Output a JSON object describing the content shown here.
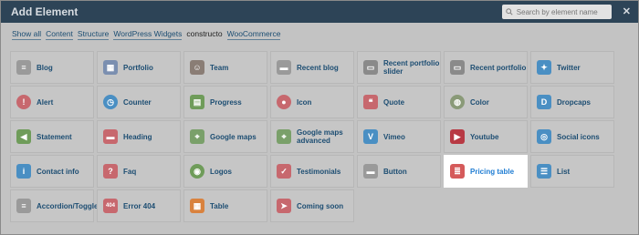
{
  "header": {
    "title": "Add Element",
    "search_placeholder": "Search by element name",
    "close": "✕"
  },
  "filters": [
    "Show all",
    "Content",
    "Structure",
    "WordPress Widgets",
    "constructo",
    "WooCommerce"
  ],
  "items": [
    {
      "label": "Blog",
      "icon": "blog-icon",
      "color": "#9a9a9a"
    },
    {
      "label": "Portfolio",
      "icon": "portfolio-icon",
      "color": "#7b8fb0"
    },
    {
      "label": "Team",
      "icon": "team-icon",
      "color": "#8a7d75"
    },
    {
      "label": "Recent blog",
      "icon": "recent-blog-icon",
      "color": "#9a9a9a"
    },
    {
      "label": "Recent portfolio slider",
      "icon": "recent-portfolio-slider-icon",
      "color": "#8a8a8a"
    },
    {
      "label": "Recent portfolio",
      "icon": "recent-portfolio-icon",
      "color": "#8a8a8a"
    },
    {
      "label": "Twitter",
      "icon": "twitter-icon",
      "color": "#4a8fc3"
    },
    {
      "label": "Alert",
      "icon": "alert-icon",
      "color": "#c7686e"
    },
    {
      "label": "Counter",
      "icon": "counter-icon",
      "color": "#4a8fc3"
    },
    {
      "label": "Progress",
      "icon": "progress-icon",
      "color": "#6f9c5a"
    },
    {
      "label": "Icon",
      "icon": "icon-icon",
      "color": "#c7686e"
    },
    {
      "label": "Quote",
      "icon": "quote-icon",
      "color": "#c7686e"
    },
    {
      "label": "Color",
      "icon": "color-icon",
      "color": "#8a9a78"
    },
    {
      "label": "Dropcaps",
      "icon": "dropcaps-icon",
      "color": "#4a8fc3"
    },
    {
      "label": "Statement",
      "icon": "statement-icon",
      "color": "#6f9c5a"
    },
    {
      "label": "Heading",
      "icon": "heading-icon",
      "color": "#c7686e"
    },
    {
      "label": "Google maps",
      "icon": "google-maps-icon",
      "color": "#7aa06a"
    },
    {
      "label": "Google maps advanced",
      "icon": "google-maps-advanced-icon",
      "color": "#7aa06a"
    },
    {
      "label": "Vimeo",
      "icon": "vimeo-icon",
      "color": "#4a8fc3"
    },
    {
      "label": "Youtube",
      "icon": "youtube-icon",
      "color": "#b83a44"
    },
    {
      "label": "Social icons",
      "icon": "social-icons-icon",
      "color": "#4a8fc3"
    },
    {
      "label": "Contact info",
      "icon": "contact-info-icon",
      "color": "#4a8fc3"
    },
    {
      "label": "Faq",
      "icon": "faq-icon",
      "color": "#c7686e"
    },
    {
      "label": "Logos",
      "icon": "logos-icon",
      "color": "#6f9c5a"
    },
    {
      "label": "Testimonials",
      "icon": "testimonials-icon",
      "color": "#c7686e"
    },
    {
      "label": "Button",
      "icon": "button-icon",
      "color": "#9a9a9a"
    },
    {
      "label": "Pricing table",
      "icon": "pricing-table-icon",
      "color": "#d55a5a",
      "highlight": true
    },
    {
      "label": "List",
      "icon": "list-icon",
      "color": "#4a8fc3"
    },
    {
      "label": "Accordion/Toggle",
      "icon": "accordion-toggle-icon",
      "color": "#9a9a9a"
    },
    {
      "label": "Error 404",
      "icon": "error-404-icon",
      "color": "#c7686e",
      "glyph": "404"
    },
    {
      "label": "Table",
      "icon": "table-icon",
      "color": "#d9823e"
    },
    {
      "label": "Coming soon",
      "icon": "coming-soon-icon",
      "color": "#c7686e"
    }
  ]
}
